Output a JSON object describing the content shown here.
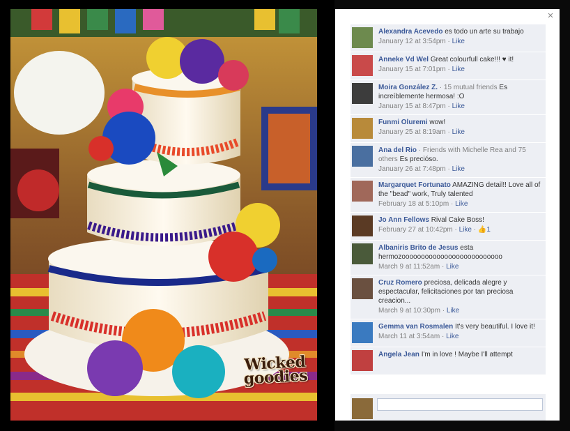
{
  "photo": {
    "watermark_line1": "Wicked",
    "watermark_line2": "goodies"
  },
  "close_label": "×",
  "comments": [
    {
      "name": "Alexandra Acevedo",
      "extra": "",
      "text": "es todo un arte su trabajo",
      "time": "January 12 at 3:54pm",
      "like": "Like",
      "likes": "",
      "avatar_color": "#6d8a4e"
    },
    {
      "name": "Anneke Vd Wel",
      "extra": "",
      "text": "Great colourfull cake!!! ♥ it!",
      "time": "January 15 at 7:01pm",
      "like": "Like",
      "likes": "",
      "avatar_color": "#c94a4a"
    },
    {
      "name": "Moira González Z.",
      "extra": "· 15 mutual friends",
      "text": "Es increíblemente hermosa! :O",
      "time": "January 15 at 8:47pm",
      "like": "Like",
      "likes": "",
      "avatar_color": "#3c3c3c"
    },
    {
      "name": "Funmi Oluremi",
      "extra": "",
      "text": "wow!",
      "time": "January 25 at 8:19am",
      "like": "Like",
      "likes": "",
      "avatar_color": "#b88a3a"
    },
    {
      "name": "Ana del Rio",
      "extra": "· Friends with Michelle Rea and 75 others",
      "text": "Es precióso.",
      "time": "January 26 at 7:48pm",
      "like": "Like",
      "likes": "",
      "avatar_color": "#4a6fa0"
    },
    {
      "name": "Margarquet Fortunato",
      "extra": "",
      "text": "AMAZING detail!! Love all of the \"bead\" work, Truly talented",
      "time": "February 18 at 5:10pm",
      "like": "Like",
      "likes": "",
      "avatar_color": "#a0685a"
    },
    {
      "name": "Jo Ann Fellows",
      "extra": "",
      "text": "Rival Cake Boss!",
      "time": "February 27 at 10:42pm",
      "like": "Like",
      "likes": "1",
      "avatar_color": "#5a3a24"
    },
    {
      "name": "Albaniris Brito de Jesus",
      "extra": "",
      "text": "esta hermozoooooooooooooooooooooooooo",
      "time": "March 9 at 11:52am",
      "like": "Like",
      "likes": "",
      "avatar_color": "#4a5a3a"
    },
    {
      "name": "Cruz Romero",
      "extra": "",
      "text": "preciosa, delicada alegre y espectacular, felicitaciones por tan preciosa creacion...",
      "time": "March 9 at 10:30pm",
      "like": "Like",
      "likes": "",
      "avatar_color": "#6a5040"
    },
    {
      "name": "Gemma van Rosmalen",
      "extra": "",
      "text": "It's very beautiful. I love it!",
      "time": "March 11 at 3:54am",
      "like": "Like",
      "likes": "",
      "avatar_color": "#3a7ac0"
    },
    {
      "name": "Angela Jean",
      "extra": "",
      "text": "I'm in love ! Maybe I'll attempt",
      "time": "",
      "like": "",
      "likes": "",
      "avatar_color": "#c04040"
    }
  ],
  "composer": {
    "placeholder": "",
    "avatar_color": "#8a6a3a"
  }
}
